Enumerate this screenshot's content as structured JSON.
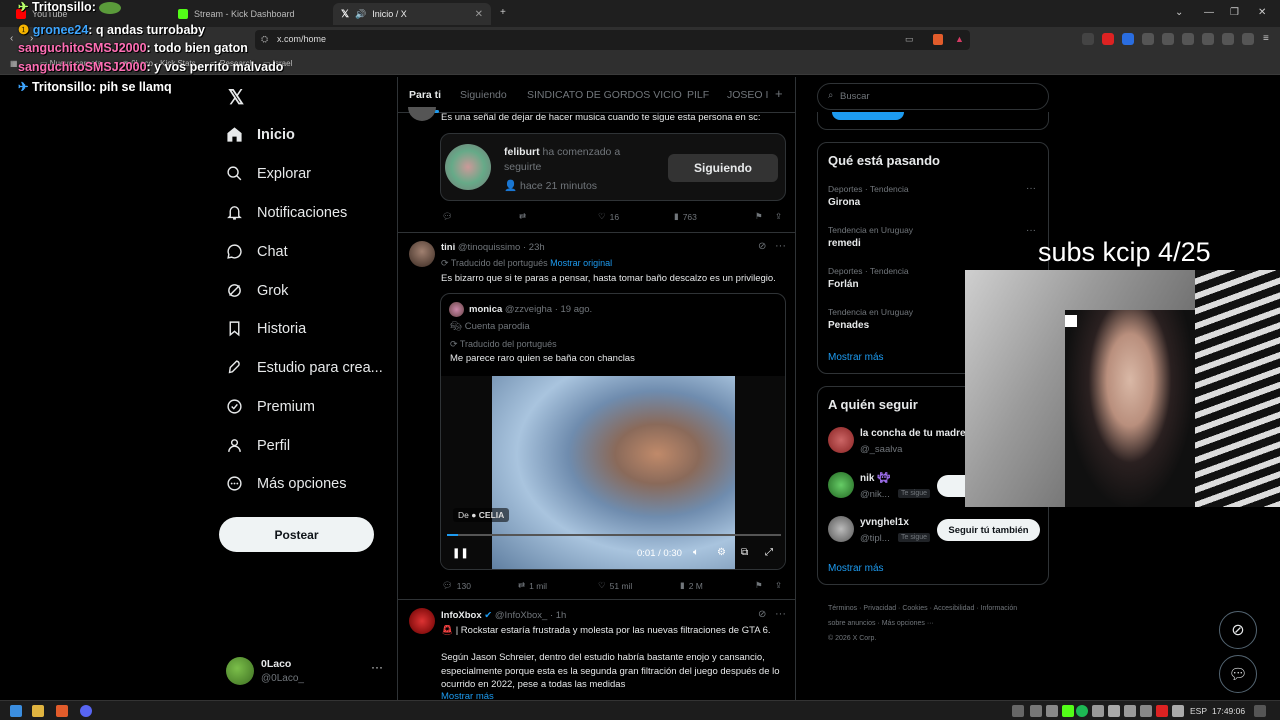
{
  "browser": {
    "tabs": [
      {
        "label": "YouTube"
      },
      {
        "label": "Stream - Kick Dashboard"
      },
      {
        "label": "Inicio / X"
      }
    ],
    "url": "x.com/home",
    "bookmarks": [
      "Nueva carpeta",
      "0Laco - Kick Stats",
      "Research",
      "Israel"
    ]
  },
  "chat": [
    {
      "user": "Tritonsillo",
      "text": ":",
      "color": "#b6ff6b"
    },
    {
      "user": "gronee24",
      "text": ": q andas turrobaby",
      "color": "#3ea6ff"
    },
    {
      "user": "sanguchitoSMSJ2000",
      "text": ": todo bien gaton",
      "color": "#ff6fb5"
    },
    {
      "user": "sanguchitoSMSJ2000",
      "text": ": y vos perrito malvado",
      "color": "#ff6fb5"
    },
    {
      "user": "Tritonsillo",
      "text": ": pih se llamq",
      "color": "#b6ff6b"
    }
  ],
  "sidebar": {
    "items": [
      {
        "label": "Inicio",
        "icon": "home-icon"
      },
      {
        "label": "Explorar",
        "icon": "search-icon"
      },
      {
        "label": "Notificaciones",
        "icon": "bell-icon"
      },
      {
        "label": "Chat",
        "icon": "chat-icon"
      },
      {
        "label": "Grok",
        "icon": "grok-icon"
      },
      {
        "label": "Historia",
        "icon": "bookmark-icon"
      },
      {
        "label": "Estudio para crea...",
        "icon": "rocket-icon"
      },
      {
        "label": "Premium",
        "icon": "verified-icon"
      },
      {
        "label": "Perfil",
        "icon": "user-icon"
      },
      {
        "label": "Más opciones",
        "icon": "more-icon"
      }
    ],
    "post_label": "Postear",
    "account": {
      "name": "0Laco",
      "handle": "@0Laco_"
    }
  },
  "feed": {
    "tabs": [
      "Para ti",
      "Siguiendo",
      "SINDICATO DE GORDOS VICIO",
      "PILF",
      "JOSEO I"
    ],
    "post1": {
      "text": "Es una señal de dejar de hacer musica cuando te sigue esta persona en sc:",
      "card_user": "feliburt",
      "card_action": "ha comenzado a seguirte",
      "card_time": "hace 21 minutos",
      "card_button": "Siguiendo",
      "likes": "16",
      "views": "763"
    },
    "post2": {
      "name": "tini",
      "handle": "@tinoquissimo",
      "time": "· 23h",
      "translated": "Traducido del portugués",
      "show_original": "Mostrar original",
      "text": "Es bizarro que si te paras a pensar, hasta tomar baño descalzo es un privilegio.",
      "quote": {
        "name": "monica",
        "handle": "@zzveigha",
        "time": "· 19 ago.",
        "parody": "Cuenta parodia",
        "translated": "Traducido del portugués",
        "text": "Me parece raro quien se baña con chanclas",
        "video_from": "De",
        "video_source": "CELIA",
        "video_time": "0:01 / 0:30"
      },
      "replies": "130",
      "reposts": "1 mil",
      "likes": "51 mil",
      "views": "2 M"
    },
    "post3": {
      "name": "InfoXbox",
      "handle": "@InfoXbox_",
      "time": "· 1h",
      "line1": "| Rockstar estaría frustrada y molesta por las nuevas filtraciones de GTA 6.",
      "body": "Según Jason Schreier, dentro del estudio habría bastante enojo y cansancio, especialmente porque esta es la segunda gran filtración del juego después de lo ocurrido en 2022, pese a todas las medidas",
      "more": "Mostrar más"
    }
  },
  "right": {
    "search_placeholder": "Buscar",
    "trends_title": "Qué está pasando",
    "trends": [
      {
        "category": "Deportes · Tendencia",
        "name": "Girona"
      },
      {
        "category": "Tendencia en Uruguay",
        "name": "remedi"
      },
      {
        "category": "Deportes · Tendencia",
        "name": "Forlán"
      },
      {
        "category": "Tendencia en Uruguay",
        "name": "Penades"
      }
    ],
    "show_more": "Mostrar más",
    "who_title": "A quién seguir",
    "who": [
      {
        "name": "la concha de tu madre",
        "handle": "@_saalva",
        "badge": "",
        "button": ""
      },
      {
        "name": "nik",
        "handle": "@nik...",
        "badge": "Te sigue",
        "button": "Segu"
      },
      {
        "name": "yvnghel1x",
        "handle": "@tipl...",
        "badge": "Te sigue",
        "button": "Seguir tú también"
      }
    ],
    "footer": [
      "Términos",
      "Privacidad",
      "Cookies",
      "Accesibilidad",
      "Información sobre anuncios",
      "Más opciones ···",
      "© 2026 X Corp."
    ]
  },
  "overlay": {
    "subs": "subs kcip 4/25"
  },
  "taskbar": {
    "lang": "ESP",
    "time": "17:49:06"
  }
}
